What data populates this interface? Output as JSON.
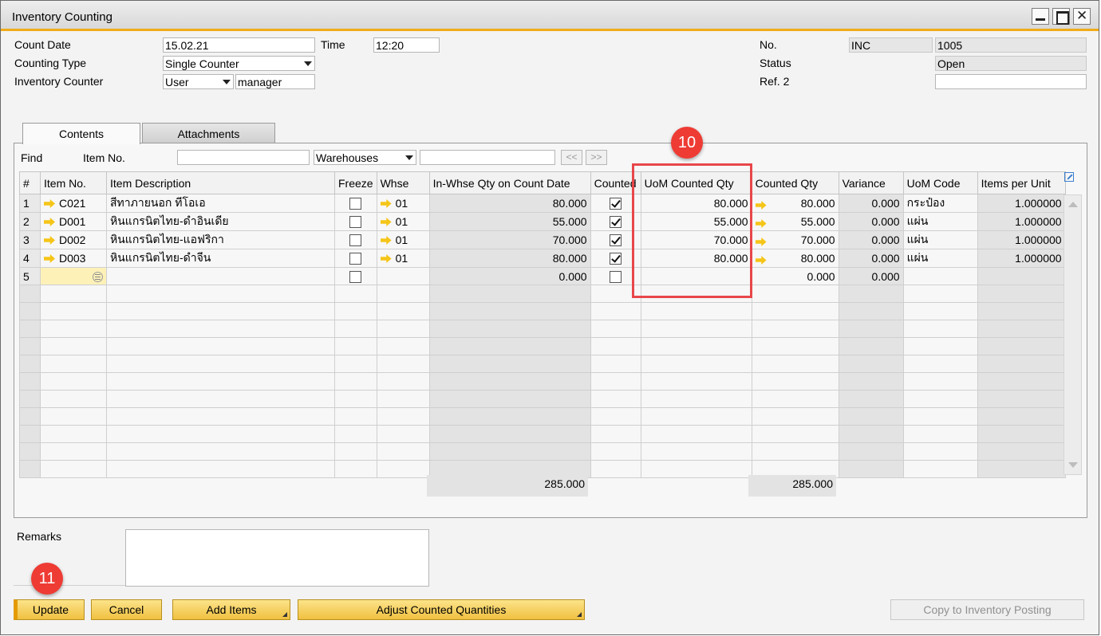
{
  "window": {
    "title": "Inventory Counting"
  },
  "header": {
    "count_date_label": "Count Date",
    "count_date": "15.02.21",
    "time_label": "Time",
    "time": "12:20",
    "counting_type_label": "Counting Type",
    "counting_type": "Single Counter",
    "inventory_counter_label": "Inventory Counter",
    "counter_type": "User",
    "counter_name": "manager",
    "no_label": "No.",
    "series": "INC",
    "number": "1005",
    "status_label": "Status",
    "status": "Open",
    "ref2_label": "Ref. 2",
    "ref2": ""
  },
  "tabs": [
    {
      "label": "Contents"
    },
    {
      "label": "Attachments"
    }
  ],
  "find": {
    "find_label": "Find",
    "item_no_label": "Item No.",
    "item_no_value": "",
    "warehouses": "Warehouses",
    "warehouse_value": "",
    "prev": "<<",
    "next": ">>"
  },
  "grid": {
    "columns": [
      "#",
      "Item No.",
      "Item Description",
      "Freeze",
      "Whse",
      "In-Whse Qty on Count Date",
      "Counted",
      "UoM Counted Qty",
      "Counted Qty",
      "Variance",
      "UoM Code",
      "Items per Unit"
    ],
    "rows": [
      {
        "num": "1",
        "item_no": "C021",
        "desc": "สีทาภายนอก ทีโอเอ",
        "whse": "01",
        "in_whse_qty": "80.000",
        "uom_counted_qty": "80.000",
        "counted_qty": "80.000",
        "variance": "0.000",
        "uom_code": "กระป๋อง",
        "items_per_unit": "1.000000"
      },
      {
        "num": "2",
        "item_no": "D001",
        "desc": "หินแกรนิตไทย-ดำอินเดีย",
        "whse": "01",
        "in_whse_qty": "55.000",
        "uom_counted_qty": "55.000",
        "counted_qty": "55.000",
        "variance": "0.000",
        "uom_code": "แผ่น",
        "items_per_unit": "1.000000"
      },
      {
        "num": "3",
        "item_no": "D002",
        "desc": "หินแกรนิตไทย-แอฟริกา",
        "whse": "01",
        "in_whse_qty": "70.000",
        "uom_counted_qty": "70.000",
        "counted_qty": "70.000",
        "variance": "0.000",
        "uom_code": "แผ่น",
        "items_per_unit": "1.000000"
      },
      {
        "num": "4",
        "item_no": "D003",
        "desc": "หินแกรนิตไทย-ดำจีน",
        "whse": "01",
        "in_whse_qty": "80.000",
        "uom_counted_qty": "80.000",
        "counted_qty": "80.000",
        "variance": "0.000",
        "uom_code": "แผ่น",
        "items_per_unit": "1.000000"
      }
    ],
    "new_row": {
      "num": "5",
      "in_whse_qty": "0.000",
      "counted_qty": "0.000",
      "variance": "0.000"
    },
    "totals": {
      "in_whse_qty": "285.000",
      "counted_qty": "285.000"
    }
  },
  "remarks": {
    "label": "Remarks",
    "value": ""
  },
  "buttons": {
    "update": "Update",
    "cancel": "Cancel",
    "add_items": "Add Items",
    "adjust": "Adjust Counted Quantities",
    "copy": "Copy to Inventory Posting"
  },
  "annotations": {
    "badge_10": "10",
    "badge_11": "11"
  },
  "colors": {
    "accent": "#f0ac18",
    "button": "#f5cf55",
    "highlight": "#e8474a",
    "badge": "#ee3b34"
  }
}
